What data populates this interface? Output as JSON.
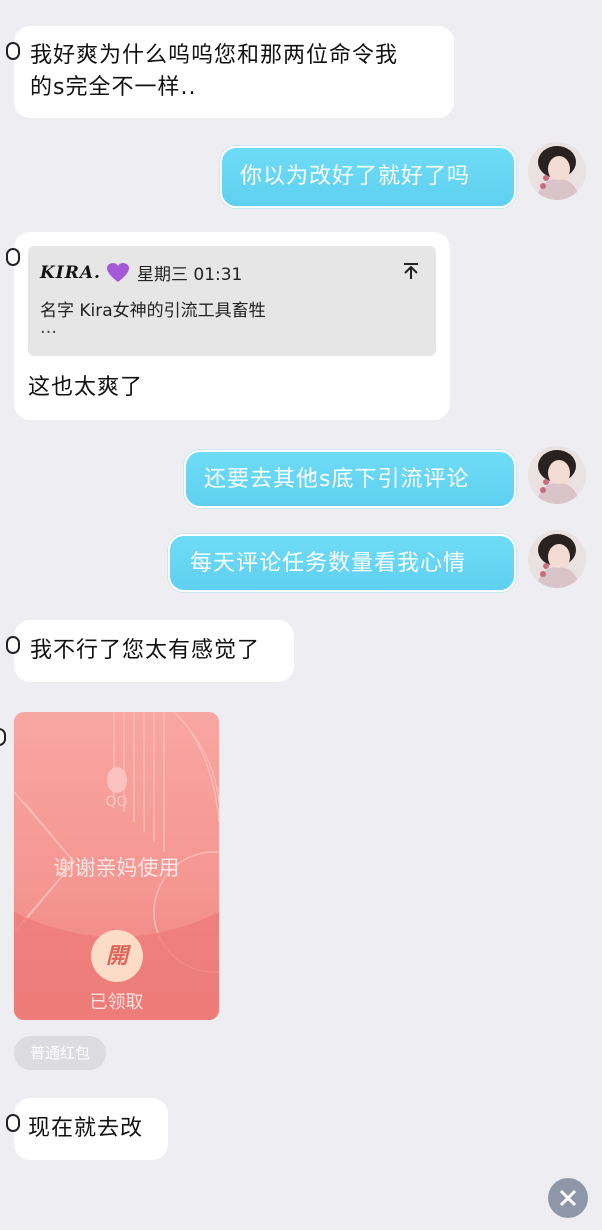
{
  "messages": {
    "m1": "我好爽为什么呜呜您和那两位命令我\n的s完全不一样..",
    "m2": "你以为改好了就好了吗",
    "m3_quote_name": "KIRA.",
    "m3_quote_time": "星期三 01:31",
    "m3_quote_text": "名字 Kira女神的引流工具畜牲",
    "m3_quote_more": "…",
    "m3_body": "这也太爽了",
    "m4": "还要去其他s底下引流评论",
    "m5": "每天评论任务数量看我心情",
    "m6": "我不行了您太有感觉了",
    "m8": "现在就去改"
  },
  "red_packet": {
    "brand": "QQ",
    "greeting": "谢谢亲妈使用",
    "open_char": "開",
    "status": "已领取",
    "type_tag": "普通红包"
  },
  "colors": {
    "background": "#eeeef2",
    "right_bubble": "#63d3f2",
    "red_packet": "#f59590"
  },
  "icons": {
    "quote_collapse": "collapse-up-icon",
    "heart": "purple-heart-icon",
    "scroll": "scroll-down-icon"
  }
}
